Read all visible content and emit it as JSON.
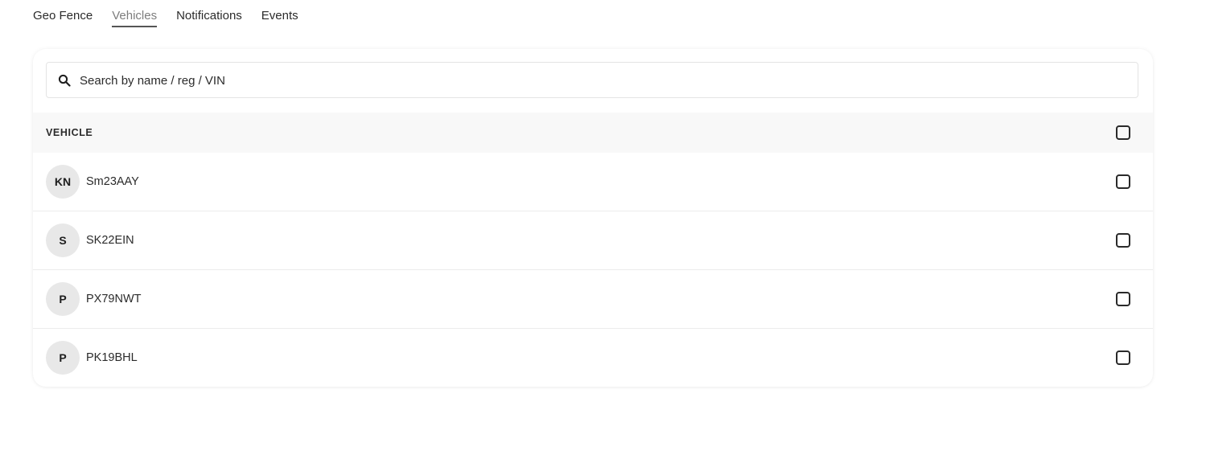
{
  "tabs": [
    {
      "label": "Geo Fence",
      "active": false
    },
    {
      "label": "Vehicles",
      "active": true
    },
    {
      "label": "Notifications",
      "active": false
    },
    {
      "label": "Events",
      "active": false
    }
  ],
  "search": {
    "placeholder": "Search by name / reg / VIN",
    "value": "",
    "icon": "search-icon"
  },
  "table": {
    "header": "VEHICLE",
    "rows": [
      {
        "initials": "KN",
        "name": "Sm23AAY",
        "checked": false
      },
      {
        "initials": "S",
        "name": "SK22EIN",
        "checked": false
      },
      {
        "initials": "P",
        "name": "PX79NWT",
        "checked": false
      },
      {
        "initials": "P",
        "name": "PK19BHL",
        "checked": false
      }
    ]
  }
}
